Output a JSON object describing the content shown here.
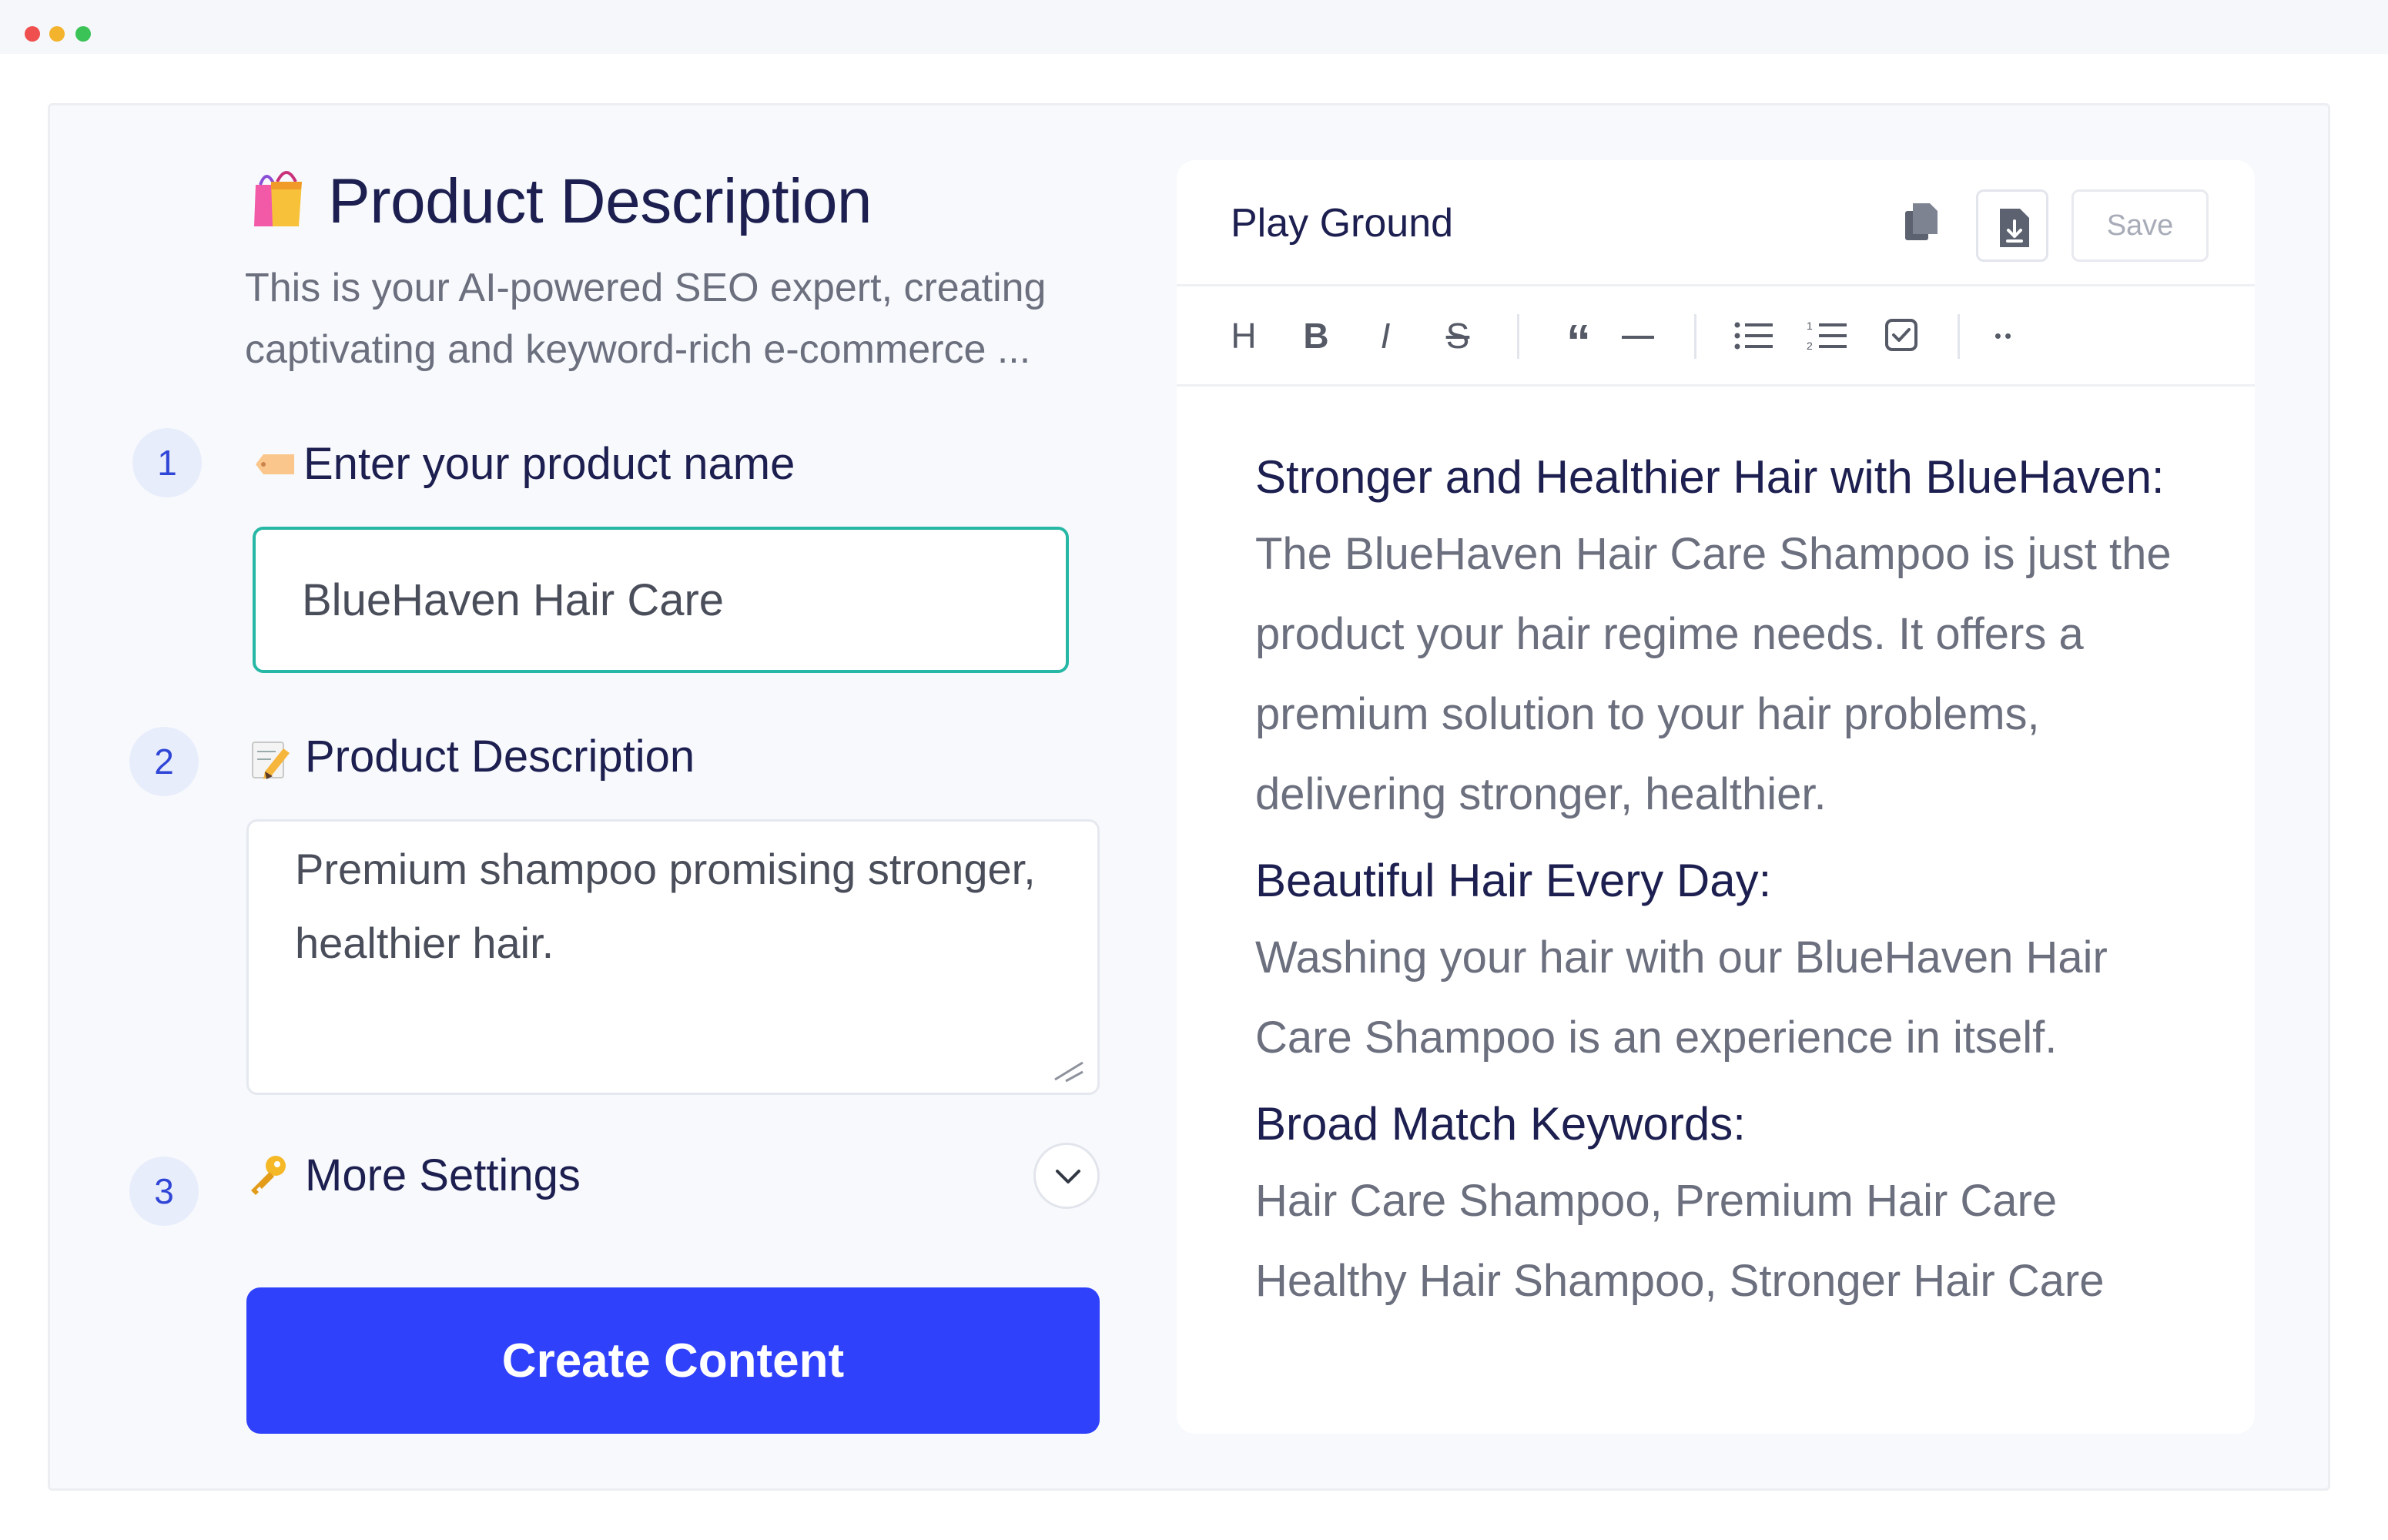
{
  "window": {
    "dots": [
      "close",
      "minimize",
      "maximize"
    ]
  },
  "left": {
    "title": "Product Description",
    "title_icon": "shopping-bags-icon",
    "description": "This is your AI-powered SEO expert, creating captivating and keyword-rich e-commerce ...",
    "steps": [
      {
        "number": "1",
        "icon": "tag-label-icon",
        "label": "Enter your product name"
      },
      {
        "number": "2",
        "icon": "memo-pencil-icon",
        "label": "Product Description"
      },
      {
        "number": "3",
        "icon": "key-icon",
        "label": "More Settings"
      }
    ],
    "product_name_value": "BlueHaven Hair Care",
    "product_description_value": "Premium shampoo promising stronger, healthier hair.",
    "create_button_label": "Create Content"
  },
  "playground": {
    "title": "Play Ground",
    "save_label": "Save",
    "toolbar": {
      "heading": "H",
      "bold": "B",
      "italic": "I",
      "strike": "S",
      "quote": "“",
      "more": "••"
    },
    "content": [
      {
        "heading": "Stronger and Healthier Hair with BlueHaven:",
        "body": "The BlueHaven Hair Care Shampoo is just the product your hair regime needs. It offers a premium solution to your hair problems, delivering stronger, healthier."
      },
      {
        "heading": "Beautiful Hair Every Day:",
        "body": "Washing your hair with our BlueHaven Hair Care Shampoo is an experience in itself."
      },
      {
        "heading": "Broad Match Keywords:",
        "body": "Hair Care Shampoo, Premium Hair Care Healthy Hair Shampoo, Stronger Hair Care"
      }
    ]
  },
  "colors": {
    "accent_blue": "#2f41fb",
    "input_focus": "#26b7a5",
    "step_bg": "#e8edfb",
    "step_text": "#3046d6"
  }
}
